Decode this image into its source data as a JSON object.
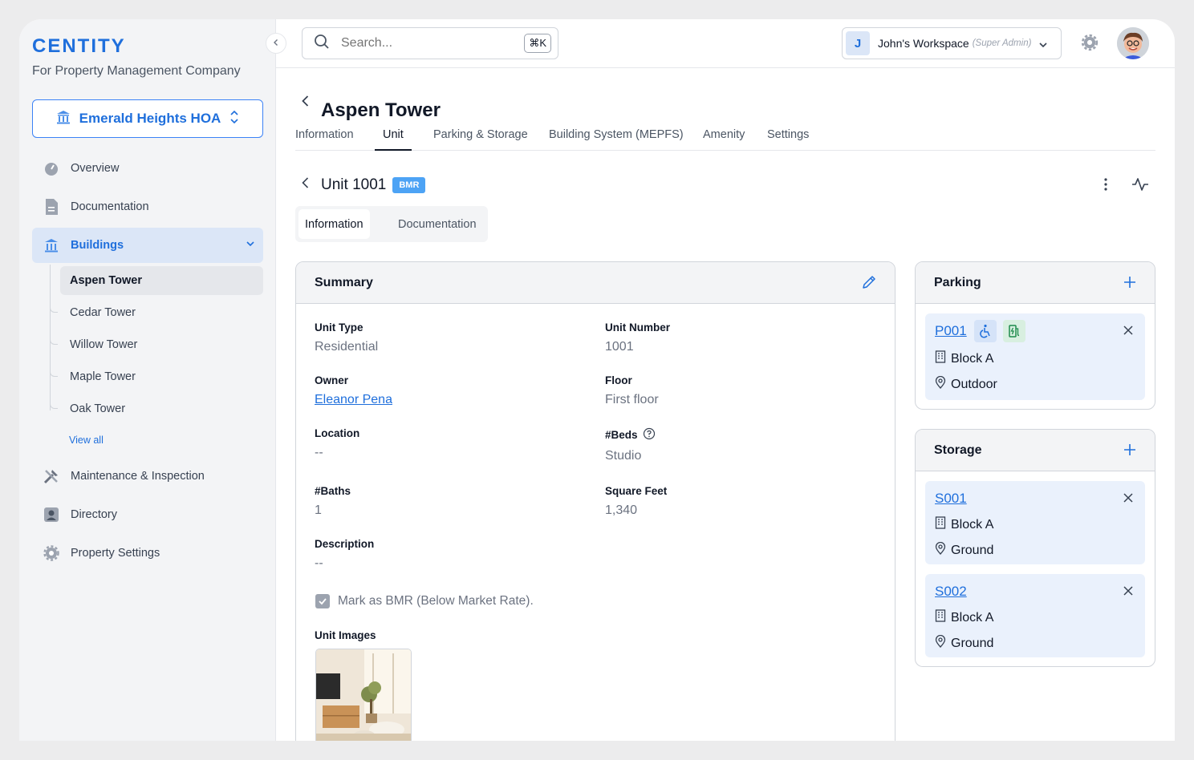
{
  "app": {
    "brand": "CENTITY",
    "subtitle": "For Property Management Company"
  },
  "sidebar": {
    "property": "Emerald Heights HOA",
    "nav": [
      {
        "label": "Overview",
        "icon": "gauge-icon"
      },
      {
        "label": "Documentation",
        "icon": "document-icon"
      },
      {
        "label": "Buildings",
        "icon": "building-icon"
      },
      {
        "label": "Maintenance & Inspection",
        "icon": "tools-icon"
      },
      {
        "label": "Directory",
        "icon": "contact-icon"
      },
      {
        "label": "Property Settings",
        "icon": "gear-icon"
      }
    ],
    "buildings": [
      "Aspen Tower",
      "Cedar Tower",
      "Willow Tower",
      "Maple Tower",
      "Oak Tower"
    ],
    "view_all": "View all"
  },
  "topbar": {
    "search_placeholder": "Search...",
    "shortcut": "⌘K",
    "workspace_initial": "J",
    "workspace_name": "John's Workspace",
    "workspace_role": "(Super Admin)"
  },
  "page": {
    "title": "Aspen Tower",
    "tabs": [
      "Information",
      "Unit",
      "Parking & Storage",
      "Building System (MEPFS)",
      "Amenity",
      "Settings"
    ],
    "active_tab": "Unit"
  },
  "unit": {
    "title": "Unit 1001",
    "badge": "BMR",
    "subtabs": [
      "Information",
      "Documentation"
    ],
    "summary_title": "Summary",
    "fields": {
      "unit_type": {
        "label": "Unit Type",
        "value": "Residential"
      },
      "unit_number": {
        "label": "Unit Number",
        "value": "1001"
      },
      "owner": {
        "label": "Owner",
        "value": "Eleanor Pena"
      },
      "floor": {
        "label": "Floor",
        "value": "First floor"
      },
      "location": {
        "label": "Location",
        "value": "--"
      },
      "beds": {
        "label": "#Beds",
        "value": "Studio"
      },
      "baths": {
        "label": "#Baths",
        "value": "1"
      },
      "sqft": {
        "label": "Square Feet",
        "value": "1,340"
      },
      "description": {
        "label": "Description",
        "value": "--"
      }
    },
    "bmr_checkbox": "Mark as BMR (Below Market Rate).",
    "images_label": "Unit Images"
  },
  "parking": {
    "title": "Parking",
    "items": [
      {
        "code": "P001",
        "block": "Block A",
        "location": "Outdoor"
      }
    ]
  },
  "storage": {
    "title": "Storage",
    "items": [
      {
        "code": "S001",
        "block": "Block A",
        "location": "Ground"
      },
      {
        "code": "S002",
        "block": "Block A",
        "location": "Ground"
      }
    ]
  },
  "colors": {
    "accent": "#1f6fdc",
    "badge": "#4da3f5",
    "item_bg": "#eaf1fc"
  }
}
